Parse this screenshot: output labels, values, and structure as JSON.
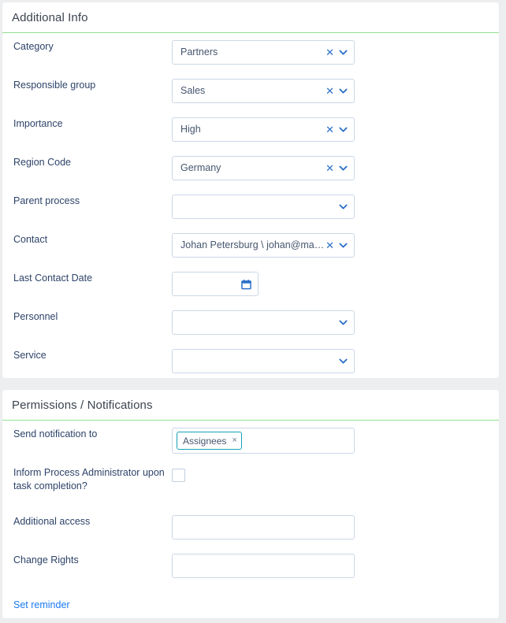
{
  "theme": {
    "page_background": "#eceef0",
    "card_background": "#ffffff",
    "accent_underline": "#8fe08f",
    "label_color": "#2e4369",
    "icon_blue": "#2a6fc9",
    "link_blue": "#1a7af0",
    "tag_border_teal": "#17a2b8",
    "input_border": "#ccd7e6"
  },
  "sections": [
    {
      "id": "additional-info",
      "title": "Additional Info",
      "fields": [
        {
          "name": "category",
          "label": "Category",
          "type": "select",
          "value": "Partners",
          "clearable": true,
          "icons": [
            "clear-icon",
            "chevron-down-icon"
          ]
        },
        {
          "name": "responsible-group",
          "label": "Responsible group",
          "type": "select",
          "value": "Sales",
          "clearable": true,
          "icons": [
            "clear-icon",
            "chevron-down-icon"
          ]
        },
        {
          "name": "importance",
          "label": "Importance",
          "type": "select",
          "value": "High",
          "clearable": true,
          "icons": [
            "clear-icon",
            "chevron-down-icon"
          ]
        },
        {
          "name": "region-code",
          "label": "Region Code",
          "type": "select",
          "value": "Germany",
          "clearable": true,
          "icons": [
            "clear-icon",
            "chevron-down-icon"
          ]
        },
        {
          "name": "parent-process",
          "label": "Parent process",
          "type": "select",
          "value": "",
          "clearable": false,
          "icons": [
            "chevron-down-icon"
          ]
        },
        {
          "name": "contact",
          "label": "Contact",
          "type": "select",
          "value": "Johan Petersburg \\ johan@mail...",
          "clearable": true,
          "icons": [
            "clear-icon",
            "chevron-down-icon"
          ]
        },
        {
          "name": "last-contact-date",
          "label": "Last Contact Date",
          "type": "date",
          "value": "",
          "clearable": false,
          "icons": [
            "calendar-icon"
          ]
        },
        {
          "name": "personnel",
          "label": "Personnel",
          "type": "select",
          "value": "",
          "clearable": false,
          "icons": [
            "chevron-down-icon"
          ]
        },
        {
          "name": "service",
          "label": "Service",
          "type": "select",
          "value": "",
          "clearable": false,
          "icons": [
            "chevron-down-icon"
          ]
        }
      ]
    },
    {
      "id": "permissions-notifications",
      "title": "Permissions / Notifications",
      "fields": [
        {
          "name": "send-notification-to",
          "label": "Send notification to",
          "type": "tags",
          "tags": [
            {
              "label": "Assignees",
              "remove": "×"
            }
          ]
        },
        {
          "name": "inform-process-administrator",
          "label": "Inform Process Administrator upon task completion?",
          "label_line1": "Inform Process Administrator upon",
          "label_line2": "task completion?",
          "type": "checkbox",
          "checked": false
        },
        {
          "name": "additional-access",
          "label": "Additional access",
          "type": "text",
          "value": ""
        },
        {
          "name": "change-rights",
          "label": "Change Rights",
          "type": "text",
          "value": ""
        }
      ],
      "footer_link": "Set reminder"
    }
  ],
  "glyphs": {
    "clear": "✕"
  }
}
